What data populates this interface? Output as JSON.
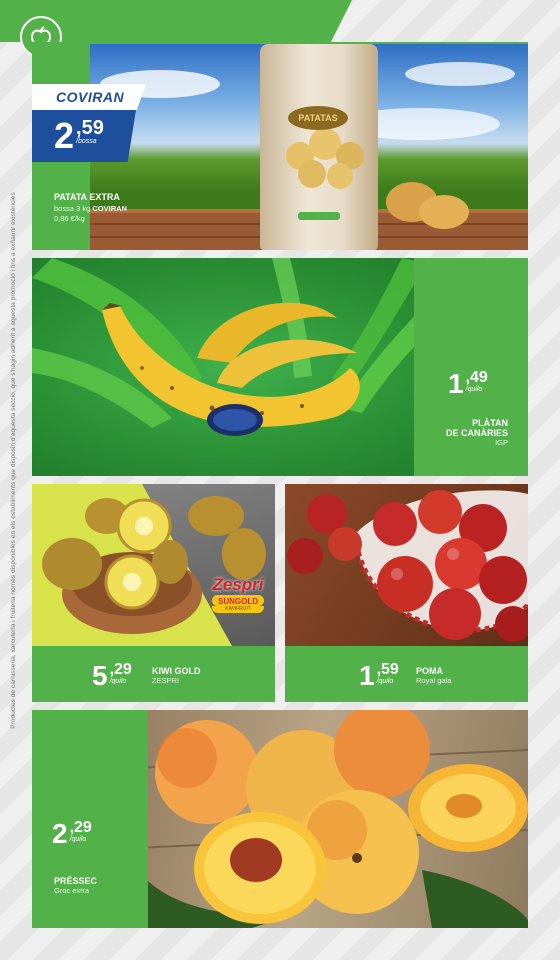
{
  "side_note": "Productes de carnisseria, xarcuteria i fruiteria només disponibles en els establiments que disposin d'aquesta secció, que s'hagin adherit a aquesta promoció i fins a exhaurir existències",
  "colors": {
    "brand_green": "#52b148",
    "brand_blue": "#1d4f9c",
    "banana_yellow": "#f0c530",
    "apple_red": "#c62a2a"
  },
  "icons": {
    "top_badge": "apple-outline-icon"
  },
  "products": [
    {
      "brand": "COVIRAN",
      "price_int": "2",
      "price_dec": ",59",
      "unit": "/bossa",
      "name": "PATATA EXTRA",
      "detail_prefix": "bossa 3 kg",
      "detail_brand": "COVIRAN",
      "unit_price": "0,86 €/kg",
      "bag_label": "PATATAS"
    },
    {
      "price_int": "1",
      "price_dec": ",49",
      "unit": "/quilo",
      "name_line1": "PLÀTAN",
      "name_line2": "DE CANÀRIES",
      "detail": "IGP"
    },
    {
      "price_int": "5",
      "price_dec": ",29",
      "unit": "/quilo",
      "name": "KIWI GOLD",
      "detail": "ZESPRI",
      "logo_brand": "Zespri",
      "logo_variety": "SUNGOLD",
      "logo_sub": "KIWIFRUIT"
    },
    {
      "price_int": "1",
      "price_dec": ",59",
      "unit": "/quilo",
      "name": "POMA",
      "detail": "Royal gala"
    },
    {
      "price_int": "2",
      "price_dec": ",29",
      "unit": "/quilo",
      "name": "PRÉSSEC",
      "detail": "Groc extra"
    }
  ]
}
